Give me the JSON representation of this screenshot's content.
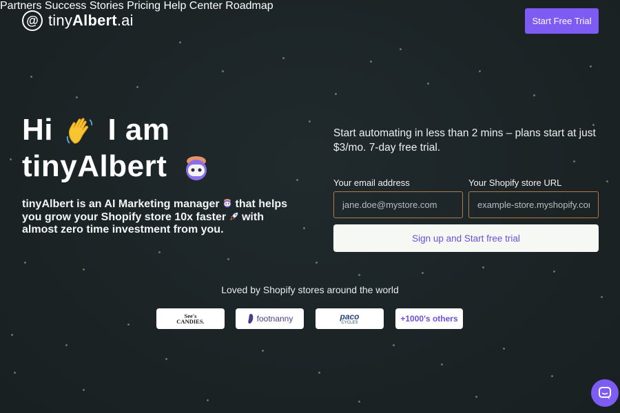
{
  "brand": {
    "logo_symbol": "@",
    "name_light": "tiny",
    "name_bold": "Albert",
    "name_suffix": ".ai"
  },
  "nav": {
    "items": [
      "Partners",
      "Success Stories",
      "Pricing",
      "Help Center",
      "Roadmap"
    ],
    "cta_label": "Start Free Trial"
  },
  "hero": {
    "title_line1_a": "Hi",
    "title_line1_b": "I am",
    "title_line2": "tinyAlbert",
    "desc_part1": "tinyAlbert is an AI Marketing manager",
    "desc_part2": "that helps you grow your Shopify store 10x faster",
    "desc_part3": "with almost zero time investment from you."
  },
  "signup": {
    "intro": "Start automating in less than 2 mins – plans start at just $3/mo. 7-day free trial.",
    "email_label": "Your email address",
    "email_placeholder": "jane.doe@mystore.com",
    "store_label": "Your Shopify store URL",
    "store_placeholder": "example-store.myshopify.com",
    "submit_label": "Sign up and Start free trial"
  },
  "social_proof": {
    "heading": "Loved by Shopify stores around the world",
    "brands": {
      "sees_line1": "See's",
      "sees_line2": "CANDIES.",
      "footnanny": "footnanny",
      "paco": "paco",
      "paco_sub": "CYCLES",
      "others": "+1000's others"
    }
  },
  "colors": {
    "background": "#1c2426",
    "accent": "#7c5cf2",
    "input_border": "#b27a4d",
    "button_bg": "#f5f8f3"
  },
  "icons": {
    "wave": "waving-hand-icon",
    "bot": "robot-face-icon",
    "rocket": "rocket-icon",
    "chat": "chat-bubble-icon"
  }
}
